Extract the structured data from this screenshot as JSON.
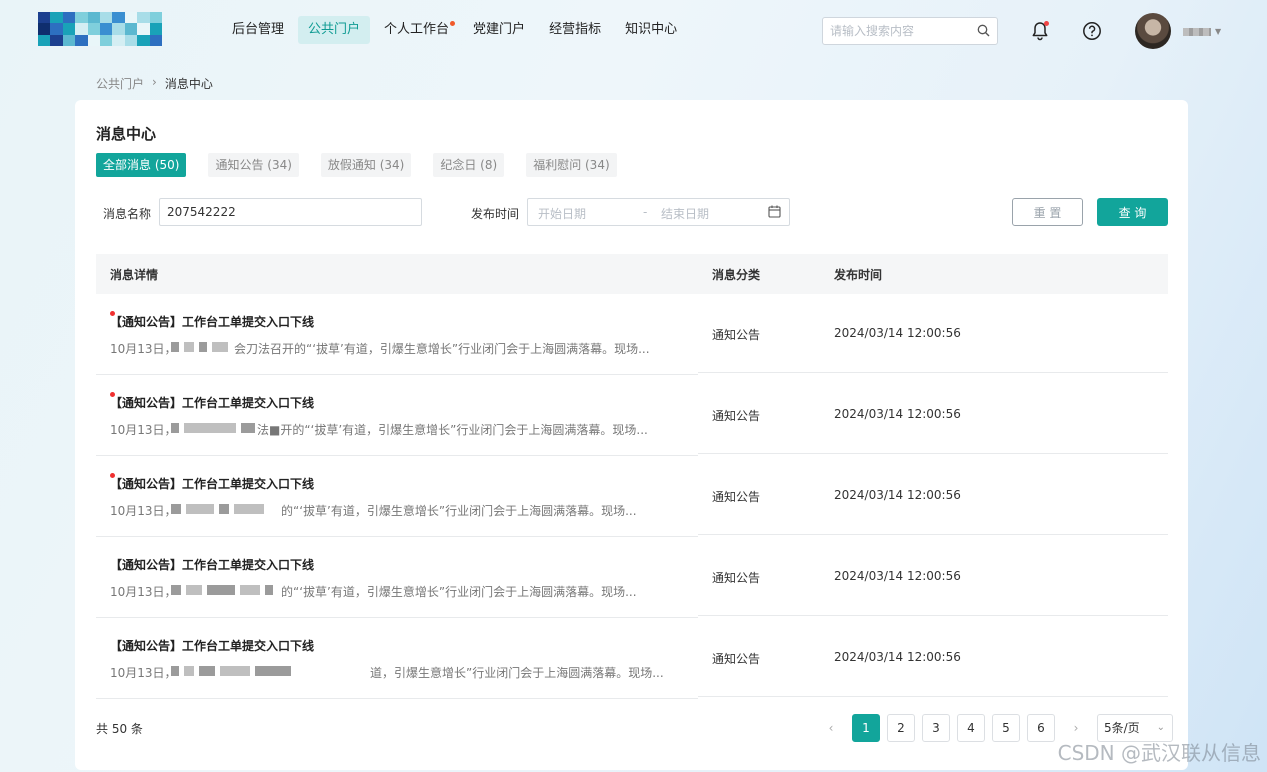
{
  "header": {
    "nav": [
      {
        "label": "后台管理",
        "active": false,
        "dot": false
      },
      {
        "label": "公共门户",
        "active": true,
        "dot": false
      },
      {
        "label": "个人工作台",
        "active": false,
        "dot": true
      },
      {
        "label": "党建门户",
        "active": false,
        "dot": false
      },
      {
        "label": "经营指标",
        "active": false,
        "dot": false
      },
      {
        "label": "知识中心",
        "active": false,
        "dot": false
      }
    ],
    "search_placeholder": "请输入搜索内容",
    "icons": {
      "search": "search-icon",
      "bell": "bell-icon",
      "help": "help-icon",
      "caret": "caret-down-icon"
    }
  },
  "breadcrumb": {
    "parent": "公共门户",
    "separator": "›",
    "current": "消息中心"
  },
  "page": {
    "title": "消息中心"
  },
  "tabs": [
    {
      "label": "全部消息 (50)",
      "active": true
    },
    {
      "label": "通知公告 (34)",
      "active": false
    },
    {
      "label": "放假通知 (34)",
      "active": false
    },
    {
      "label": "纪念日 (8)",
      "active": false
    },
    {
      "label": "福利慰问 (34)",
      "active": false
    }
  ],
  "filters": {
    "name_label": "消息名称",
    "name_value": "207542222",
    "time_label": "发布时间",
    "start_placeholder": "开始日期",
    "range_separator": "-",
    "end_placeholder": "结束日期",
    "reset_label": "重 置",
    "query_label": "查 询"
  },
  "table": {
    "headers": {
      "detail": "消息详情",
      "category": "消息分类",
      "time": "发布时间"
    },
    "rows": [
      {
        "title": "【通知公告】工作台工单提交入口下线",
        "unread": true,
        "prefix": "10月13日，",
        "desc": "会刀法召开的“‘拔草’有道，引爆生意增长”行业闭门会于上海圆满落幕。现场...",
        "category": "通知公告",
        "time": "2024/03/14 12:00:56"
      },
      {
        "title": "【通知公告】工作台工单提交入口下线",
        "unread": true,
        "prefix": "10月13日，",
        "desc": "法■开的“‘拔草’有道，引爆生意增长”行业闭门会于上海圆满落幕。现场...",
        "category": "通知公告",
        "time": "2024/03/14 12:00:56"
      },
      {
        "title": "【通知公告】工作台工单提交入口下线",
        "unread": true,
        "prefix": "10月13日，",
        "desc": "的“‘拔草’有道，引爆生意增长”行业闭门会于上海圆满落幕。现场...",
        "category": "通知公告",
        "time": "2024/03/14 12:00:56"
      },
      {
        "title": "【通知公告】工作台工单提交入口下线",
        "unread": false,
        "prefix": "10月13日，",
        "desc": "的“‘拔草’有道，引爆生意增长”行业闭门会于上海圆满落幕。现场...",
        "category": "通知公告",
        "time": "2024/03/14 12:00:56"
      },
      {
        "title": "【通知公告】工作台工单提交入口下线",
        "unread": false,
        "prefix": "10月13日，",
        "desc": "道，引爆生意增长”行业闭门会于上海圆满落幕。现场...",
        "category": "通知公告",
        "time": "2024/03/14 12:00:56"
      }
    ]
  },
  "pagination": {
    "total_text": "共 50 条",
    "pages": [
      "1",
      "2",
      "3",
      "4",
      "5",
      "6"
    ],
    "current": "1",
    "prev": "‹",
    "next": "›",
    "page_size": "5条/页"
  },
  "watermark": "CSDN @武汉联从信息",
  "colors": {
    "accent": "#12a59b",
    "unread_dot": "#f03030",
    "nav_active_bg": "#d3eef0"
  }
}
